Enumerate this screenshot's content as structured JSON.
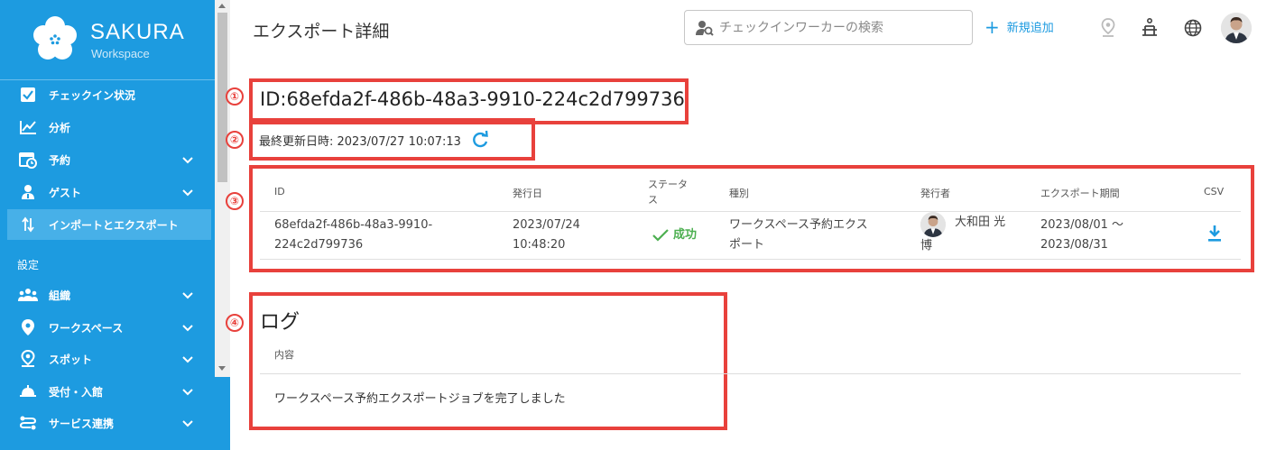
{
  "brand": {
    "name": "SAKURA",
    "sub": "Workspace"
  },
  "sidebar": {
    "items": [
      {
        "label": "チェックイン状況"
      },
      {
        "label": "分析"
      },
      {
        "label": "予約"
      },
      {
        "label": "ゲスト"
      },
      {
        "label": "インポートとエクスポート"
      }
    ],
    "settings_label": "設定",
    "settings_items": [
      {
        "label": "組織"
      },
      {
        "label": "ワークスペース"
      },
      {
        "label": "スポット"
      },
      {
        "label": "受付・入館"
      },
      {
        "label": "サービス連携"
      }
    ]
  },
  "header": {
    "title": "エクスポート詳細",
    "search_placeholder": "チェックインワーカーの検索",
    "add_label": "新規追加"
  },
  "detail": {
    "id_text": "ID:68efda2f-486b-48a3-9910-224c2d799736",
    "last_updated": "最終更新日時: 2023/07/27 10:07:13"
  },
  "markers": [
    "①",
    "②",
    "③",
    "④"
  ],
  "table": {
    "columns": [
      "ID",
      "発行日",
      "ステータス",
      "種別",
      "発行者",
      "エクスポート期間",
      "CSV"
    ],
    "row": {
      "id_line1": "68efda2f-486b-48a3-9910-",
      "id_line2": "224c2d799736",
      "date_line1": "2023/07/24",
      "date_line2": "10:48:20",
      "status": "成功",
      "type_line1": "ワークスペース予約エクス",
      "type_line2": "ポート",
      "issuer_line1": "大和田 光",
      "issuer_line2": "博",
      "period_line1": "2023/08/01 ～",
      "period_line2": "2023/08/31"
    }
  },
  "log": {
    "title": "ログ",
    "column": "内容",
    "entry": "ワークスペース予約エクスポートジョブを完了しました"
  },
  "colors": {
    "sidebar": "#1d9be0",
    "accent": "#1d9be0",
    "highlight": "#e8413c",
    "success": "#4caf50"
  }
}
